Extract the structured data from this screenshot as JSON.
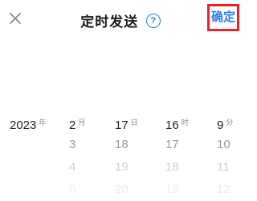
{
  "header": {
    "title": "定时发送",
    "help_icon": "question-circle-icon",
    "help_glyph": "?",
    "confirm_label": "确定",
    "close_icon": "close-icon",
    "accent_color": "#2f7ee8",
    "highlight_color": "#e8232d"
  },
  "picker": {
    "year": {
      "unit": "年",
      "selected": "2023"
    },
    "month": {
      "unit": "月",
      "selected": "2",
      "next": [
        "3",
        "4",
        "5"
      ]
    },
    "day": {
      "unit": "日",
      "selected": "17",
      "next": [
        "18",
        "19",
        "20"
      ]
    },
    "hour": {
      "unit": "时",
      "selected": "16",
      "next": [
        "17",
        "18",
        "19"
      ]
    },
    "minute": {
      "unit": "分",
      "selected": "9",
      "next": [
        "10",
        "11",
        "12"
      ]
    }
  }
}
